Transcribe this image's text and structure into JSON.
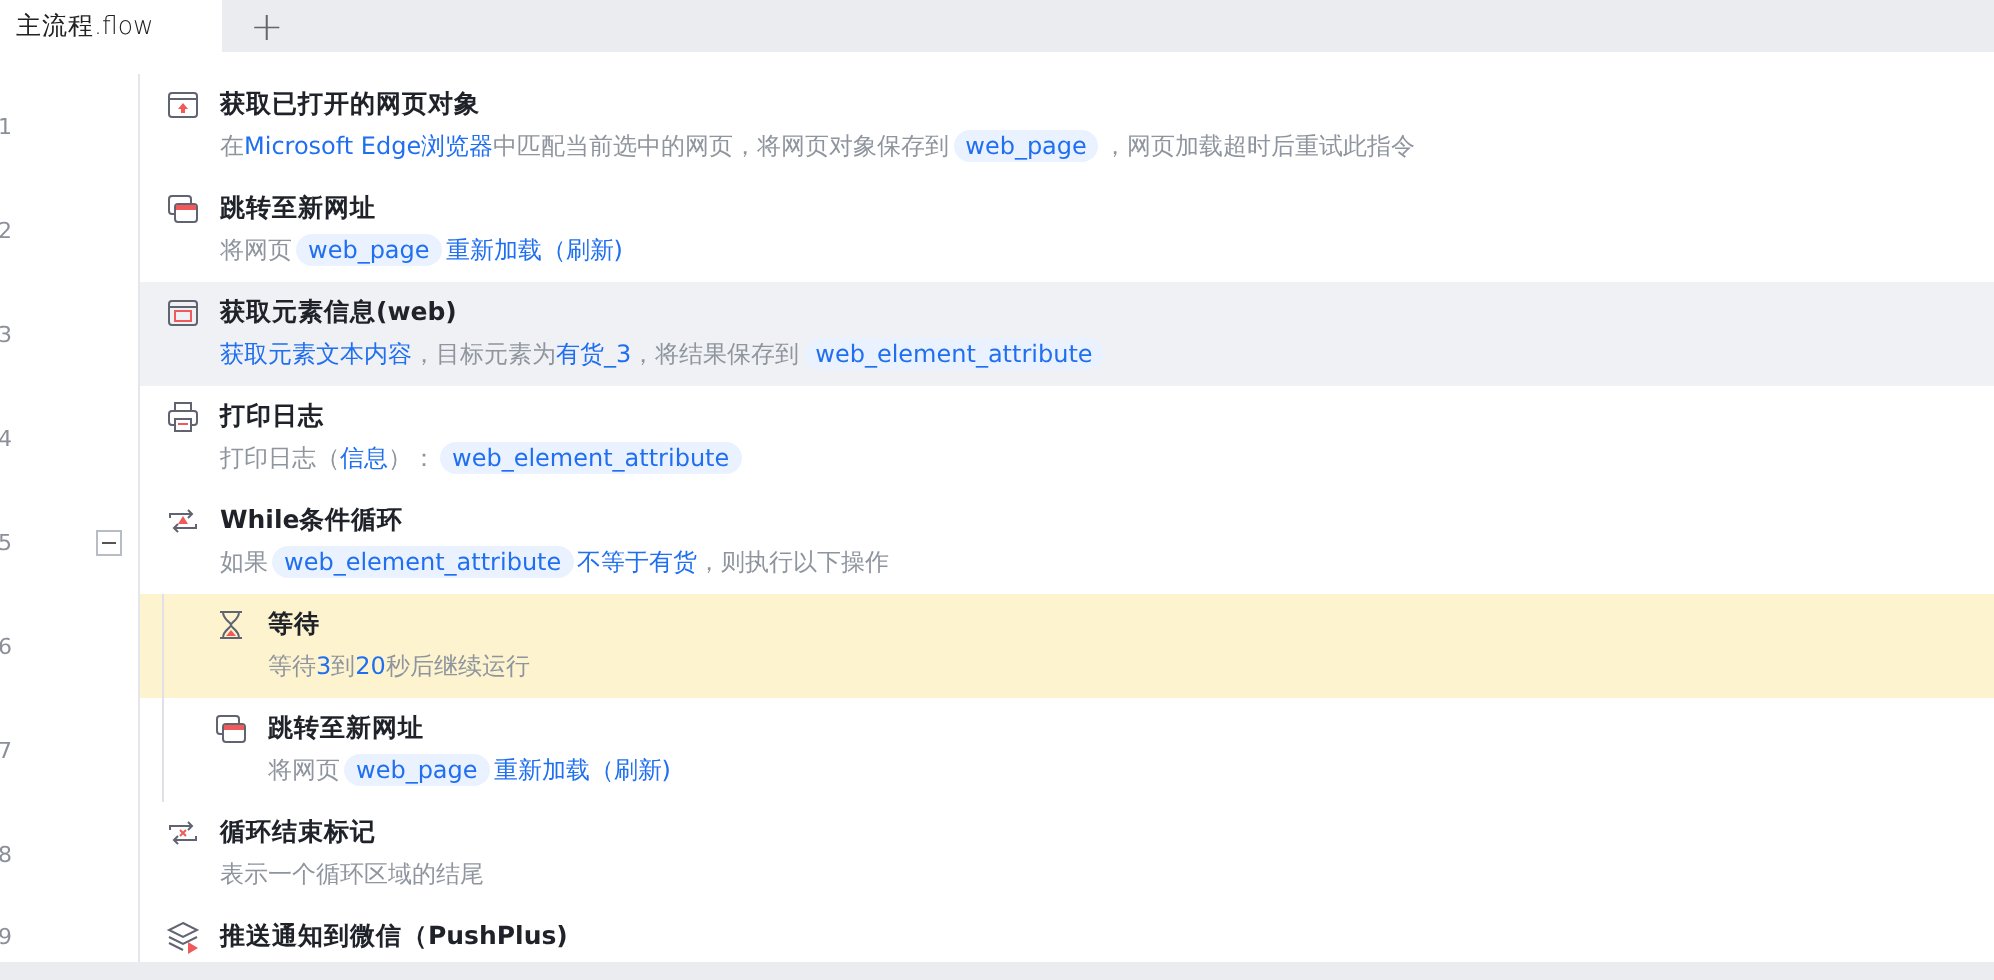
{
  "tabs": [
    {
      "label": "主流程.flow",
      "selected": true
    },
    {
      "label": "+",
      "kind": "add",
      "selected": false
    }
  ],
  "steps": [
    {
      "line": "1",
      "kind": "browser",
      "title": "获取已打开的网页对象",
      "selected": false,
      "highlighted": false,
      "description": [
        {
          "kind": "text",
          "text": "在"
        },
        {
          "kind": "link",
          "text": "Microsoft Edge浏览器"
        },
        {
          "kind": "text",
          "text": "中匹配当前选中的网页，将网页对象保存到"
        },
        {
          "kind": "var",
          "text": "web_page"
        },
        {
          "kind": "text",
          "text": "，网页加载超时后重试此指令"
        }
      ]
    },
    {
      "line": "2",
      "kind": "tabs",
      "title": "跳转至新网址",
      "selected": false,
      "highlighted": false,
      "description": [
        {
          "kind": "text",
          "text": "将网页"
        },
        {
          "kind": "var",
          "text": "web_page"
        },
        {
          "kind": "link",
          "text": "重新加载（刷新)"
        }
      ]
    },
    {
      "line": "3",
      "kind": "element",
      "title": "获取元素信息(web)",
      "selected": true,
      "highlighted": false,
      "description": [
        {
          "kind": "link",
          "text": "获取元素文本内容"
        },
        {
          "kind": "text",
          "text": "，目标元素为"
        },
        {
          "kind": "link",
          "text": "有货_3"
        },
        {
          "kind": "text",
          "text": "，将结果保存到"
        },
        {
          "kind": "var",
          "text": "web_element_attribute"
        }
      ]
    },
    {
      "line": "4",
      "kind": "printer",
      "title": "打印日志",
      "selected": false,
      "highlighted": false,
      "description": [
        {
          "kind": "text",
          "text": "打印日志（"
        },
        {
          "kind": "link",
          "text": "信息"
        },
        {
          "kind": "text",
          "text": "）："
        },
        {
          "kind": "var",
          "text": "web_element_attribute"
        }
      ]
    },
    {
      "line": "5",
      "kind": "loop",
      "title": "While条件循环",
      "selected": false,
      "highlighted": false,
      "expanded": true,
      "description": [
        {
          "kind": "text",
          "text": "如果"
        },
        {
          "kind": "var",
          "text": "web_element_attribute"
        },
        {
          "kind": "link",
          "text": "不等于有货"
        },
        {
          "kind": "text",
          "text": "，则执行以下操作"
        }
      ],
      "children": [
        {
          "line": "6",
          "kind": "hourglass",
          "title": "等待",
          "selected": false,
          "highlighted": true,
          "description": [
            {
              "kind": "text",
              "text": "等待"
            },
            {
              "kind": "link",
              "text": "3"
            },
            {
              "kind": "text",
              "text": "到"
            },
            {
              "kind": "link",
              "text": "20"
            },
            {
              "kind": "text",
              "text": "秒后继续运行"
            }
          ]
        },
        {
          "line": "7",
          "kind": "tabs",
          "title": "跳转至新网址",
          "selected": false,
          "highlighted": false,
          "description": [
            {
              "kind": "text",
              "text": "将网页"
            },
            {
              "kind": "var",
              "text": "web_page"
            },
            {
              "kind": "link",
              "text": "重新加载（刷新)"
            }
          ]
        }
      ]
    },
    {
      "line": "8",
      "kind": "loopend",
      "title": "循环结束标记",
      "selected": false,
      "highlighted": false,
      "description": [
        {
          "kind": "text",
          "text": "表示一个循环区域的结尾"
        }
      ]
    },
    {
      "line": "9",
      "kind": "layers",
      "title": "推送通知到微信（PushPlus)",
      "selected": false,
      "highlighted": false
    }
  ]
}
